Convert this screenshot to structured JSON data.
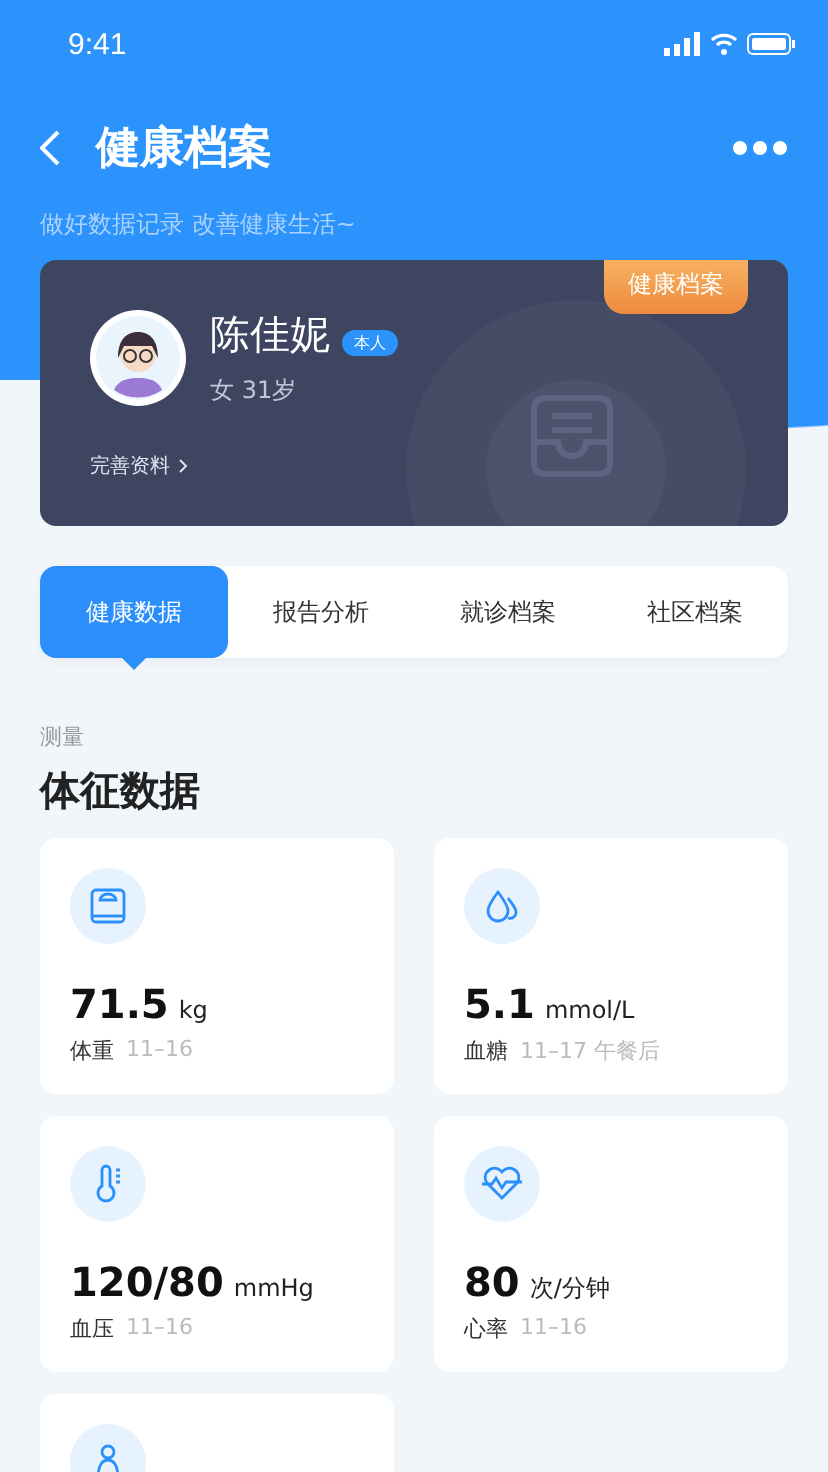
{
  "status_bar": {
    "time": "9:41"
  },
  "header": {
    "title": "健康档案",
    "subtitle": "做好数据记录 改善健康生活~"
  },
  "profile": {
    "ribbon": "健康档案",
    "name": "陈佳妮",
    "badge": "本人",
    "info": "女 31岁",
    "link": "完善资料"
  },
  "tabs": [
    {
      "label": "健康数据",
      "selected": true
    },
    {
      "label": "报告分析",
      "selected": false
    },
    {
      "label": "就诊档案",
      "selected": false
    },
    {
      "label": "社区档案",
      "selected": false
    }
  ],
  "section": {
    "caption": "测量",
    "title": "体征数据"
  },
  "metrics": [
    {
      "kind": "weight",
      "value": "71.5",
      "unit": "kg",
      "label": "体重",
      "date": "11–16"
    },
    {
      "kind": "glucose",
      "value": "5.1",
      "unit": "mmol/L",
      "label": "血糖",
      "date": "11–17 午餐后"
    },
    {
      "kind": "temperature",
      "value": "120/80",
      "unit": "mmHg",
      "label": "血压",
      "date": "11–16"
    },
    {
      "kind": "heart",
      "value": "80",
      "unit": "次/分钟",
      "label": "心率",
      "date": "11–16"
    },
    {
      "kind": "body"
    }
  ]
}
